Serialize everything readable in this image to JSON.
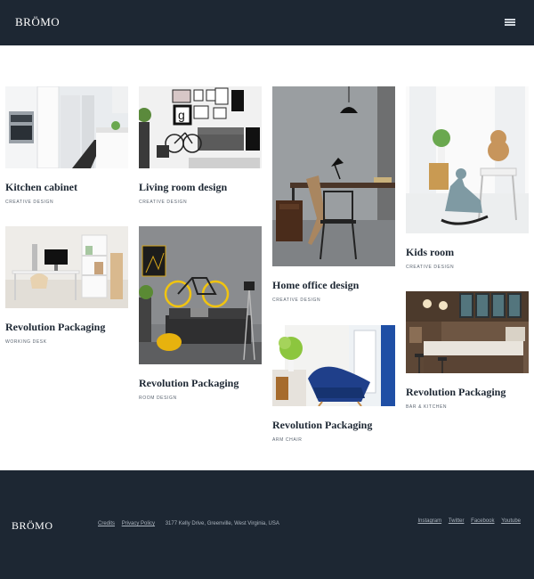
{
  "header": {
    "logo": "BRÖMO",
    "menu_icon": "hamburger-icon"
  },
  "cards": [
    {
      "title": "Kitchen cabinet",
      "subtitle": "CREATIVE DESIGN"
    },
    {
      "title": "Living room design",
      "subtitle": "CREATIVE DESIGN"
    },
    {
      "title": "Home office design",
      "subtitle": "CREATIVE DESIGN"
    },
    {
      "title": "Kids room",
      "subtitle": "CREATIVE DESIGN"
    },
    {
      "title": "Revolution Packaging",
      "subtitle": "WORKING DESK"
    },
    {
      "title": "Revolution Packaging",
      "subtitle": "ROOM DESIGN"
    },
    {
      "title": "Revolution Packaging",
      "subtitle": "ARM CHAIR"
    },
    {
      "title": "Revolution Packaging",
      "subtitle": "BAR & KITCHEN"
    }
  ],
  "footer": {
    "logo": "BRÖMO",
    "links": {
      "credits": "Credits",
      "privacy": "Privacy Policy"
    },
    "address": "3177 Kelly Drive, Greenville, West Virginia, USA",
    "social": {
      "instagram": "Instagram",
      "twitter": "Twitter",
      "facebook": "Facebook",
      "youtube": "Youtube"
    }
  },
  "colors": {
    "dark": "#1d2733",
    "muted": "#aab3bd"
  }
}
